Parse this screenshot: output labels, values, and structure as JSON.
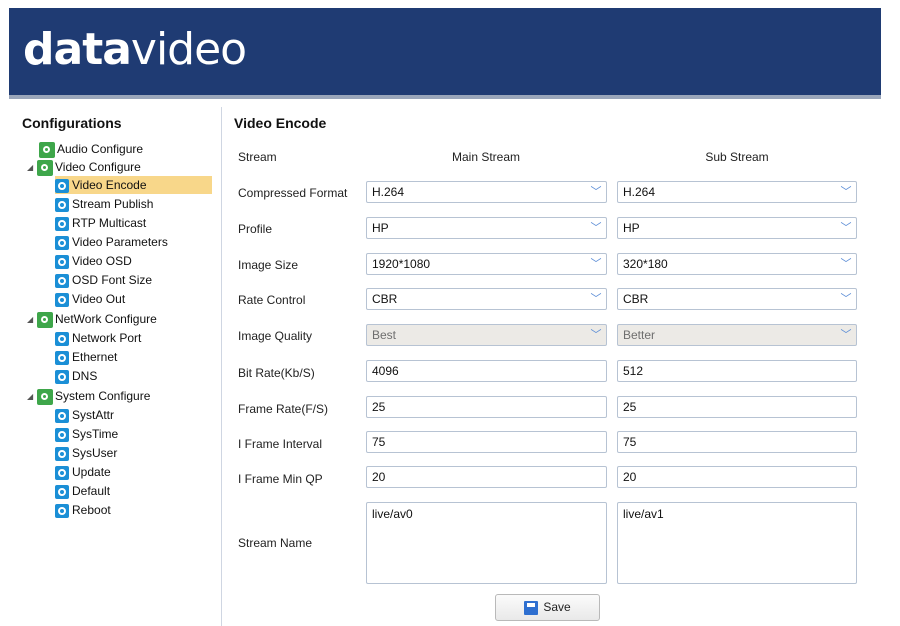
{
  "brand": {
    "logo_bold": "data",
    "logo_light": "video"
  },
  "sidebar": {
    "title": "Configurations",
    "items": [
      {
        "label": "Audio Configure"
      },
      {
        "label": "Video Configure"
      },
      {
        "label": "Video Encode"
      },
      {
        "label": "Stream Publish"
      },
      {
        "label": "RTP Multicast"
      },
      {
        "label": "Video Parameters"
      },
      {
        "label": "Video OSD"
      },
      {
        "label": "OSD Font Size"
      },
      {
        "label": "Video Out"
      },
      {
        "label": "NetWork Configure"
      },
      {
        "label": "Network Port"
      },
      {
        "label": "Ethernet"
      },
      {
        "label": "DNS"
      },
      {
        "label": "System Configure"
      },
      {
        "label": "SystAttr"
      },
      {
        "label": "SysTime"
      },
      {
        "label": "SysUser"
      },
      {
        "label": "Update"
      },
      {
        "label": "Default"
      },
      {
        "label": "Reboot"
      }
    ],
    "selected": "Video Encode"
  },
  "main": {
    "title": "Video Encode",
    "columns": {
      "label": "Stream",
      "main": "Main Stream",
      "sub": "Sub Stream"
    },
    "rows": {
      "compressed_format": {
        "label": "Compressed Format",
        "main": "H.264",
        "sub": "H.264"
      },
      "profile": {
        "label": "Profile",
        "main": "HP",
        "sub": "HP"
      },
      "image_size": {
        "label": "Image Size",
        "main": "1920*1080",
        "sub": "320*180"
      },
      "rate_control": {
        "label": "Rate Control",
        "main": "CBR",
        "sub": "CBR"
      },
      "image_quality": {
        "label": "Image Quality",
        "main": "Best",
        "sub": "Better"
      },
      "bit_rate": {
        "label": "Bit Rate(Kb/S)",
        "main": "4096",
        "sub": "512"
      },
      "frame_rate": {
        "label": "Frame Rate(F/S)",
        "main": "25",
        "sub": "25"
      },
      "i_frame_interval": {
        "label": "I Frame Interval",
        "main": "75",
        "sub": "75"
      },
      "i_frame_min_qp": {
        "label": "I Frame Min QP",
        "main": "20",
        "sub": "20"
      },
      "stream_name": {
        "label": "Stream Name",
        "main": "live/av0",
        "sub": "live/av1"
      }
    },
    "save_label": "Save"
  },
  "colors": {
    "header_bg": "#1f3b73",
    "selected_bg": "#f8d78a",
    "group_icon": "#3ea64a",
    "item_icon": "#1b8fd6"
  }
}
